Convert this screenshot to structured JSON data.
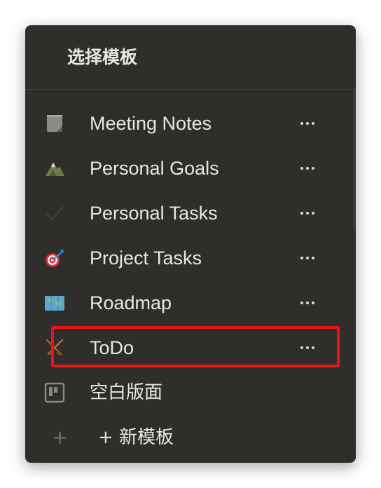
{
  "menu": {
    "title": "选择模板",
    "templates": [
      {
        "label": "Meeting Notes",
        "icon": "notepad-icon"
      },
      {
        "label": "Personal Goals",
        "icon": "mountain-icon"
      },
      {
        "label": "Personal Tasks",
        "icon": "checkmark-icon"
      },
      {
        "label": "Project Tasks",
        "icon": "dart-target-icon"
      },
      {
        "label": "Roadmap",
        "icon": "map-icon"
      },
      {
        "label": "ToDo",
        "icon": "crossed-swords-icon"
      }
    ],
    "blank": {
      "label": "空白版面",
      "icon": "board-icon"
    },
    "new_template": {
      "label": "+ 新模板",
      "icon": "plus-icon"
    },
    "more_glyph": "•••"
  },
  "colors": {
    "panel_bg": "#2f2e2b",
    "text": "#e9e7e2",
    "highlight": "#e8141a"
  }
}
